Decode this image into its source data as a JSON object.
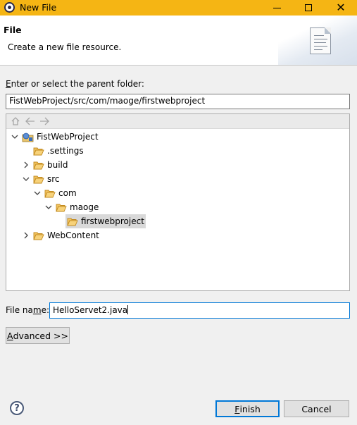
{
  "window": {
    "title": "New File"
  },
  "header": {
    "title": "File",
    "description": "Create a new file resource."
  },
  "parent_folder": {
    "label_first": "E",
    "label_rest": "nter or select the parent folder:",
    "value": "FistWebProject/src/com/maoge/firstwebproject"
  },
  "toolbar": {
    "home_icon": "home-icon",
    "back_icon": "back-arrow-icon",
    "forward_icon": "forward-arrow-icon"
  },
  "tree": {
    "root": "FistWebProject",
    "settings": ".settings",
    "build": "build",
    "src": "src",
    "com": "com",
    "maoge": "maoge",
    "firstwebproject": "firstwebproject",
    "webcontent": "WebContent"
  },
  "file_name": {
    "label_pre": "File na",
    "label_underlined": "m",
    "label_post": "e:",
    "value": "HelloServet2.java"
  },
  "buttons": {
    "advanced_first": "A",
    "advanced_rest": "dvanced >>",
    "finish_first": "F",
    "finish_rest": "inish",
    "cancel": "Cancel",
    "help": "?"
  },
  "colors": {
    "titlebar": "#f5b514",
    "folder": "#e9a42c",
    "focus": "#0078d7"
  }
}
